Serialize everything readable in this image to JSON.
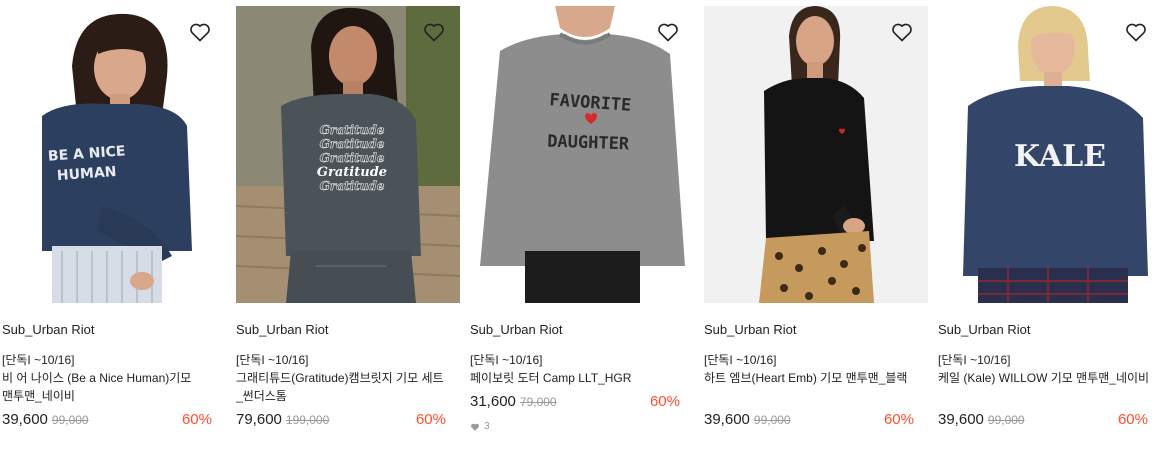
{
  "products": [
    {
      "brand": "Sub_Urban Riot",
      "tag": "[단독I ~10/16]",
      "name": "비 어 나이스 (Be a Nice Human)기모 맨투맨_네이비",
      "price": "39,600",
      "original_price": "99,000",
      "discount": "60%",
      "print_text": [
        "BE A NICE",
        "HUMAN"
      ],
      "shirt_color": "#2c3f5e",
      "bg_color": "#ffffff",
      "heart_icon": "heart-outline-icon"
    },
    {
      "brand": "Sub_Urban Riot",
      "tag": "[단독I ~10/16]",
      "name": "그래티튜드(Gratitude)캠브릿지 기모 세트_썬더스톰",
      "price": "79,600",
      "original_price": "199,000",
      "discount": "60%",
      "print_text": [
        "Gratitude",
        "Gratitude",
        "Gratitude",
        "Gratitude",
        "Gratitude"
      ],
      "shirt_color": "#4b5359",
      "bg_color": "#8c8a78",
      "heart_icon": "heart-outline-icon"
    },
    {
      "brand": "Sub_Urban Riot",
      "tag": "[단독I ~10/16]",
      "name": "페이보릿 도터 Camp LLT_HGR",
      "price": "31,600",
      "original_price": "79,000",
      "discount": "60%",
      "likes": "3",
      "print_text": [
        "FAVORITE",
        "DAUGHTER"
      ],
      "shirt_color": "#8a8a8a",
      "bg_color": "#ffffff",
      "heart_icon": "heart-outline-icon"
    },
    {
      "brand": "Sub_Urban Riot",
      "tag": "[단독I ~10/16]",
      "name": "하트 엠브(Heart Emb) 기모 맨투맨_블랙",
      "price": "39,600",
      "original_price": "99,000",
      "discount": "60%",
      "print_text": [],
      "shirt_color": "#1a1a1a",
      "bg_color": "#f2f2f2",
      "heart_icon": "heart-outline-icon"
    },
    {
      "brand": "Sub_Urban Riot",
      "tag": "[단독I ~10/16]",
      "name": "케일 (Kale) WILLOW 기모 맨투맨_네이비",
      "price": "39,600",
      "original_price": "99,000",
      "discount": "60%",
      "print_text": [
        "KALE"
      ],
      "shirt_color": "#34456a",
      "bg_color": "#ffffff",
      "heart_icon": "heart-outline-icon"
    }
  ]
}
